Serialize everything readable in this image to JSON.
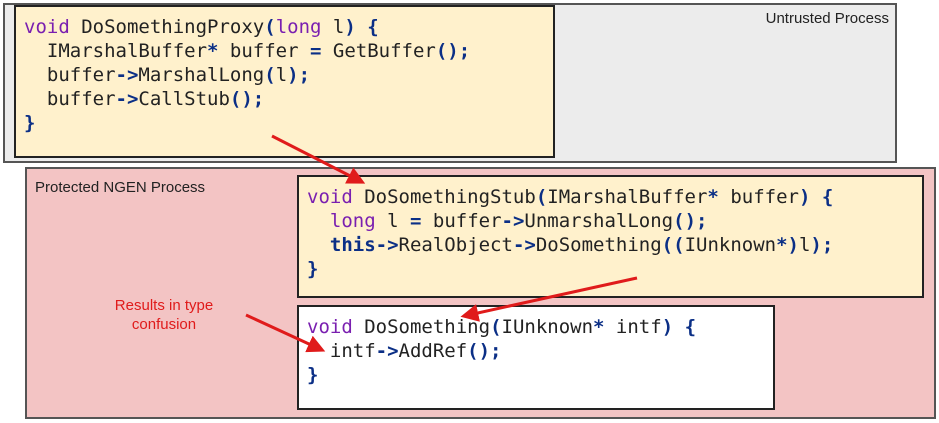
{
  "untrusted_panel": {
    "label": "Untrusted Process",
    "bg": "#ececec"
  },
  "protected_panel": {
    "label": "Protected NGEN Process",
    "bg": "#f3c4c4"
  },
  "proxy_code": {
    "bg": "#fff1cc",
    "lines": [
      [
        [
          "kw",
          "void"
        ],
        [
          "id",
          " "
        ],
        [
          "fn",
          "DoSomethingProxy"
        ],
        [
          "op",
          "("
        ],
        [
          "kw",
          "long"
        ],
        [
          "id",
          " l"
        ],
        [
          "op",
          ")"
        ],
        [
          "id",
          " "
        ],
        [
          "op",
          "{"
        ]
      ],
      [
        [
          "id",
          "  IMarshalBuffer"
        ],
        [
          "op",
          "*"
        ],
        [
          "id",
          " buffer "
        ],
        [
          "op",
          "="
        ],
        [
          "id",
          " "
        ],
        [
          "fn",
          "GetBuffer"
        ],
        [
          "op",
          "();"
        ]
      ],
      [
        [
          "id",
          "  buffer"
        ],
        [
          "op",
          "->"
        ],
        [
          "fn",
          "MarshalLong"
        ],
        [
          "op",
          "("
        ],
        [
          "id",
          "l"
        ],
        [
          "op",
          ");"
        ]
      ],
      [
        [
          "id",
          "  buffer"
        ],
        [
          "op",
          "->"
        ],
        [
          "fn",
          "CallStub"
        ],
        [
          "op",
          "();"
        ]
      ],
      [
        [
          "op",
          "}"
        ]
      ]
    ]
  },
  "stub_code": {
    "bg": "#fff1cc",
    "lines": [
      [
        [
          "kw",
          "void"
        ],
        [
          "id",
          " "
        ],
        [
          "fn",
          "DoSomethingStub"
        ],
        [
          "op",
          "("
        ],
        [
          "id",
          "IMarshalBuffer"
        ],
        [
          "op",
          "*"
        ],
        [
          "id",
          " buffer"
        ],
        [
          "op",
          ")"
        ],
        [
          "id",
          " "
        ],
        [
          "op",
          "{"
        ]
      ],
      [
        [
          "id",
          "  "
        ],
        [
          "kw",
          "long"
        ],
        [
          "id",
          " l "
        ],
        [
          "op",
          "="
        ],
        [
          "id",
          " buffer"
        ],
        [
          "op",
          "->"
        ],
        [
          "fn",
          "UnmarshalLong"
        ],
        [
          "op",
          "();"
        ]
      ],
      [
        [
          "id",
          "  "
        ],
        [
          "kw2",
          "this"
        ],
        [
          "op",
          "->"
        ],
        [
          "id",
          "RealObject"
        ],
        [
          "op",
          "->"
        ],
        [
          "fn",
          "DoSomething"
        ],
        [
          "op",
          "(("
        ],
        [
          "id",
          "IUnknown"
        ],
        [
          "op",
          "*)"
        ],
        [
          "id",
          "l"
        ],
        [
          "op",
          ");"
        ]
      ],
      [
        [
          "op",
          "}"
        ]
      ]
    ]
  },
  "target_code": {
    "bg": "#ffffff",
    "lines": [
      [
        [
          "kw",
          "void"
        ],
        [
          "id",
          " "
        ],
        [
          "fn",
          "DoSomething"
        ],
        [
          "op",
          "("
        ],
        [
          "id",
          "IUnknown"
        ],
        [
          "op",
          "*"
        ],
        [
          "id",
          " intf"
        ],
        [
          "op",
          ")"
        ],
        [
          "id",
          " "
        ],
        [
          "op",
          "{"
        ]
      ],
      [
        [
          "id",
          "  intf"
        ],
        [
          "op",
          "->"
        ],
        [
          "fn",
          "AddRef"
        ],
        [
          "op",
          "();"
        ]
      ],
      [
        [
          "op",
          "}"
        ]
      ]
    ]
  },
  "note": {
    "text_line1": "Results in type",
    "text_line2": "confusion"
  },
  "arrow_color": "#e01b1b"
}
